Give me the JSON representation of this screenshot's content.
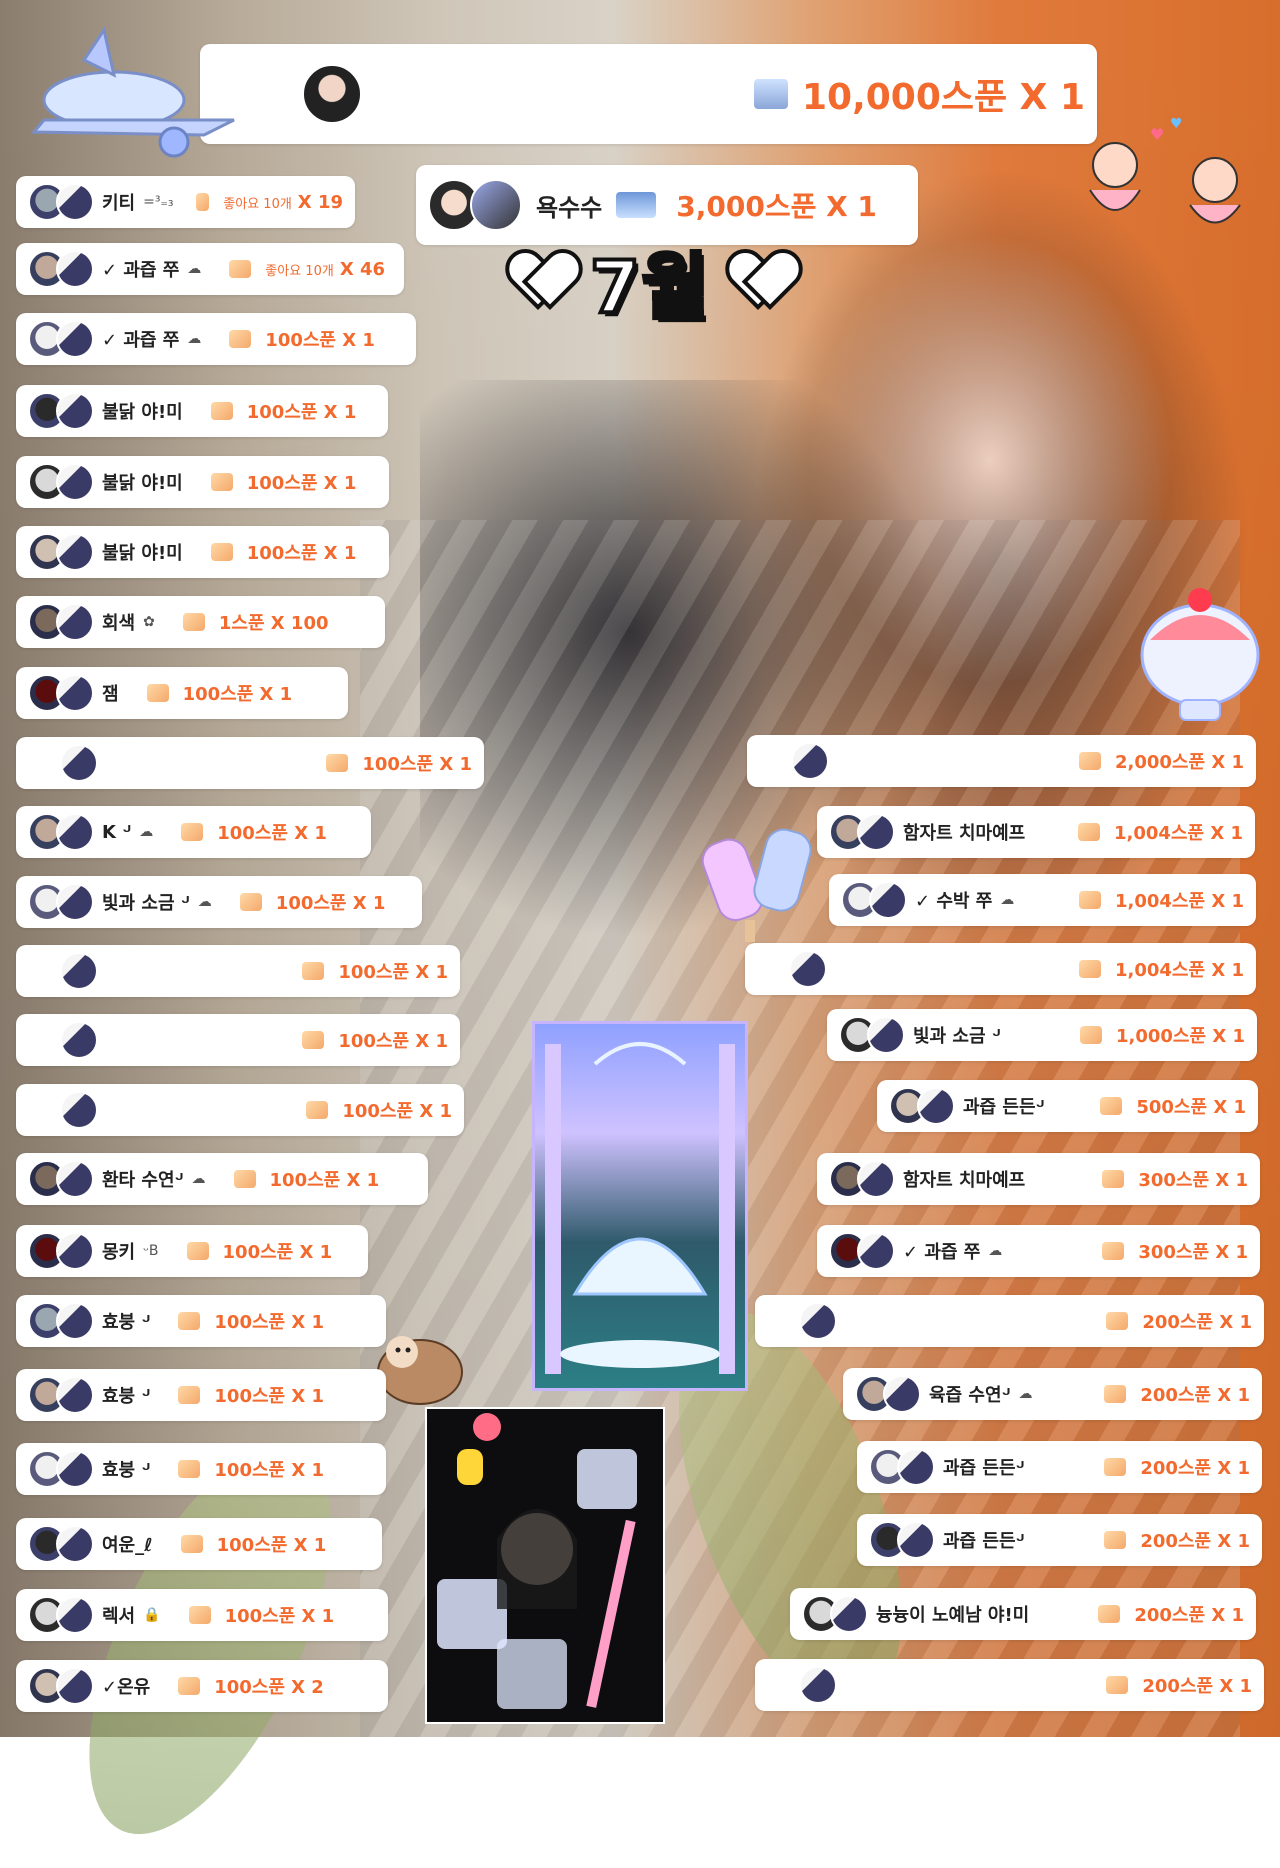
{
  "title": {
    "heart_left": "♥",
    "month": "7월",
    "heart_right": "♥"
  },
  "colors": {
    "accent": "#f26a2e",
    "card": "#ffffff",
    "orange_wall": "#e07a3c"
  },
  "top_card": {
    "gift": "10,000스푼 X 1",
    "icon": "gift-box-icon"
  },
  "second_card": {
    "name": "욕수수",
    "gift": "3,000스푼 X 1",
    "icon": "gift-image-icon"
  },
  "left": [
    {
      "name": "키티",
      "emoji": "=³₌₃",
      "sub": "좋아요 10개",
      "gift": "X 19"
    },
    {
      "name": "✓ 과즙 쭈",
      "emoji": "☁",
      "sub": "좋아요 10개",
      "gift": "X 46"
    },
    {
      "name": "✓ 과즙 쭈",
      "emoji": "☁",
      "gift": "100스푼 X 1"
    },
    {
      "name": "불닭 야!미",
      "emoji": "",
      "gift": "100스푼 X 1"
    },
    {
      "name": "불닭 야!미",
      "emoji": "",
      "gift": "100스푼 X 1"
    },
    {
      "name": "불닭 야!미",
      "emoji": "",
      "gift": "100스푼 X 1"
    },
    {
      "name": "회색",
      "emoji": "✿",
      "gift": "1스푼 X 100"
    },
    {
      "name": "잼",
      "emoji": "",
      "gift": "100스푼 X 1"
    },
    {
      "name": "",
      "emoji": "",
      "gift": "100스푼 X 1"
    },
    {
      "name": "K ᒢ",
      "emoji": "☁",
      "gift": "100스푼 X 1"
    },
    {
      "name": "빛과 소금 ᒢ",
      "emoji": "☁",
      "gift": "100스푼 X 1"
    },
    {
      "name": "",
      "emoji": "",
      "gift": "100스푼 X 1"
    },
    {
      "name": "",
      "emoji": "",
      "gift": "100스푼 X 1"
    },
    {
      "name": "",
      "emoji": "",
      "gift": "100스푼 X 1"
    },
    {
      "name": "환타 수연ᒢ",
      "emoji": "☁",
      "gift": "100스푼 X 1"
    },
    {
      "name": "몽키",
      "emoji": "ᵕB",
      "gift": "100스푼 X 1"
    },
    {
      "name": "효붕 ᒢ",
      "emoji": "",
      "gift": "100스푼 X 1"
    },
    {
      "name": "효붕 ᒢ",
      "emoji": "",
      "gift": "100스푼 X 1"
    },
    {
      "name": "효붕 ᒢ",
      "emoji": "",
      "gift": "100스푼 X 1"
    },
    {
      "name": "여운_ℓ",
      "emoji": "",
      "gift": "100스푼 X 1"
    },
    {
      "name": "렉서",
      "emoji": "🔒",
      "gift": "100스푼 X 1"
    },
    {
      "name": "✓온유",
      "emoji": "",
      "gift": "100스푼 X 2"
    }
  ],
  "right": [
    {
      "name": "",
      "emoji": "",
      "gift": "2,000스푼 X 1"
    },
    {
      "name": "함자트 치마예프",
      "emoji": "",
      "gift": "1,004스푼 X 1"
    },
    {
      "name": "✓ 수박 쭈",
      "emoji": "☁",
      "gift": "1,004스푼 X 1"
    },
    {
      "name": "",
      "emoji": "",
      "gift": "1,004스푼 X 1"
    },
    {
      "name": "빛과 소금 ᒢ",
      "emoji": "",
      "gift": "1,000스푼 X 1"
    },
    {
      "name": "과즙 든든ᒢ",
      "emoji": "",
      "gift": "500스푼 X 1"
    },
    {
      "name": "함자트 치마예프",
      "emoji": "",
      "gift": "300스푼 X 1"
    },
    {
      "name": "✓ 과즙 쭈",
      "emoji": "☁",
      "gift": "300스푼 X 1"
    },
    {
      "name": "",
      "emoji": "",
      "gift": "200스푼 X 1"
    },
    {
      "name": "육즙 수연ᒢ",
      "emoji": "☁",
      "gift": "200스푼 X 1"
    },
    {
      "name": "과즙 든든ᒢ",
      "emoji": "",
      "gift": "200스푼 X 1"
    },
    {
      "name": "과즙 든든ᒢ",
      "emoji": "",
      "gift": "200스푼 X 1"
    },
    {
      "name": "늉늉이 노예남 야!미",
      "emoji": "",
      "gift": "200스푼 X 1"
    },
    {
      "name": "",
      "emoji": "",
      "gift": "200스푼 X 1"
    }
  ]
}
